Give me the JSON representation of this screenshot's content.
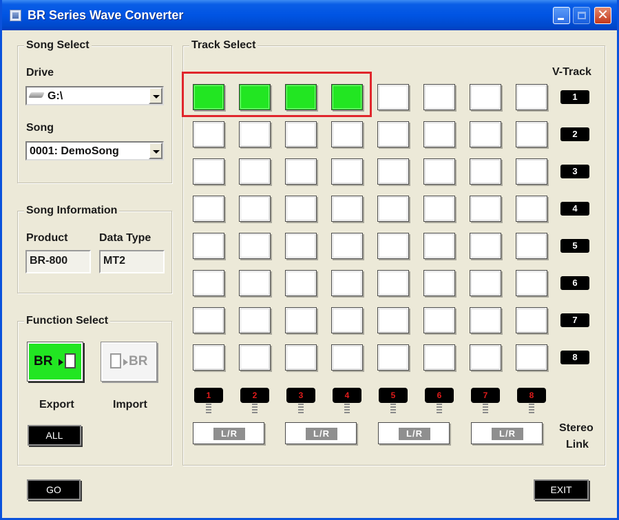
{
  "window": {
    "title": "BR Series Wave Converter",
    "icons": {
      "app": "app-icon",
      "minimize": "minimize-icon",
      "maximize": "maximize-icon",
      "close": "close-icon"
    }
  },
  "song_select": {
    "legend": "Song Select",
    "drive_label": "Drive",
    "drive_value": "G:\\",
    "song_label": "Song",
    "song_value": "0001: DemoSong"
  },
  "song_information": {
    "legend": "Song Information",
    "product_label": "Product",
    "product_value": "BR-800",
    "data_type_label": "Data Type",
    "data_type_value": "MT2"
  },
  "function_select": {
    "legend": "Function Select",
    "export_button_text": "BR",
    "import_button_text": "BR",
    "export_label": "Export",
    "import_label": "Import",
    "selected": "Export",
    "all_button": "ALL"
  },
  "track_select": {
    "legend": "Track Select",
    "vtrack_header": "V-Track",
    "vtracks": [
      "1",
      "2",
      "3",
      "4",
      "5",
      "6",
      "7",
      "8"
    ],
    "tracks": [
      "1",
      "2",
      "3",
      "4",
      "5",
      "6",
      "7",
      "8"
    ],
    "selected_cells": [
      [
        0,
        0
      ],
      [
        0,
        1
      ],
      [
        0,
        2
      ],
      [
        0,
        3
      ]
    ],
    "stereo_link_label_1": "Stereo",
    "stereo_link_label_2": "Link",
    "stereo_buttons": [
      "L/R",
      "L/R",
      "L/R",
      "L/R"
    ]
  },
  "footer": {
    "go_button": "GO",
    "exit_button": "EXIT"
  },
  "colors": {
    "selected_cell": "#22e622",
    "title_bar": "#0054e3",
    "highlight": "#e0262c",
    "track_number": "#e11b1b"
  }
}
